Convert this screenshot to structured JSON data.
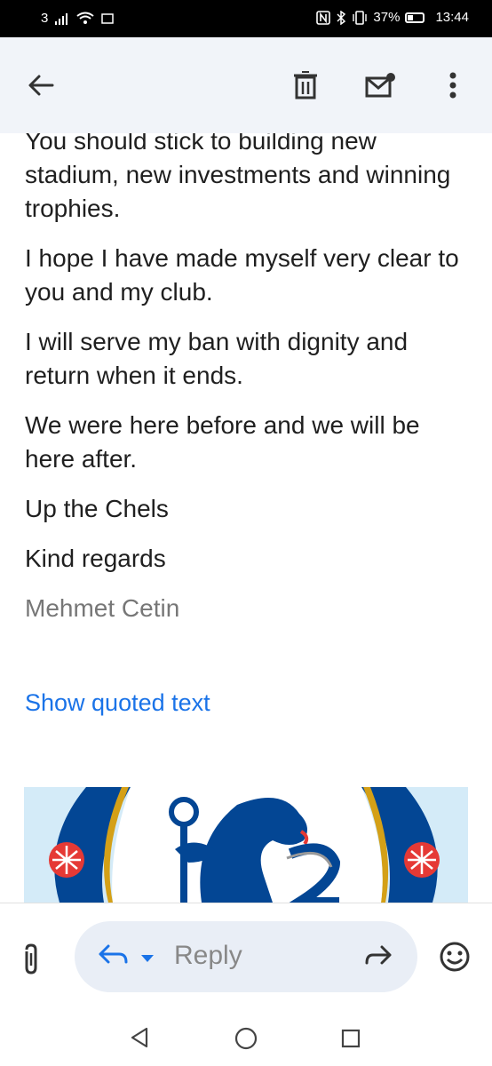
{
  "status": {
    "carrier": "3",
    "battery": "37%",
    "time": "13:44"
  },
  "app_bar": {
    "back_icon": "back-arrow-icon",
    "delete_icon": "trash-icon",
    "unread_icon": "mark-unread-icon",
    "more_icon": "more-vert-icon"
  },
  "email": {
    "partial_line": "You should stick to building new",
    "paragraphs": [
      "stadium, new investments and winning trophies.",
      "I hope I have made myself very clear to you and my club.",
      "I will serve my ban with dignity and return when it ends.",
      "We were here before  and we will be here after.",
      "Up the Chels",
      "Kind regards"
    ],
    "signature": "Mehmet Cetin",
    "show_quoted": "Show quoted text"
  },
  "compose": {
    "reply_label": "Reply",
    "attach_icon": "paperclip-icon",
    "reply_icon": "reply-icon",
    "dropdown_icon": "caret-down-icon",
    "forward_icon": "forward-icon",
    "emoji_icon": "emoji-icon"
  },
  "colors": {
    "accent": "#1a73e8",
    "app_bar_bg": "#f1f4f9",
    "pill_bg": "#e9eef6",
    "chelsea_blue": "#034694"
  }
}
